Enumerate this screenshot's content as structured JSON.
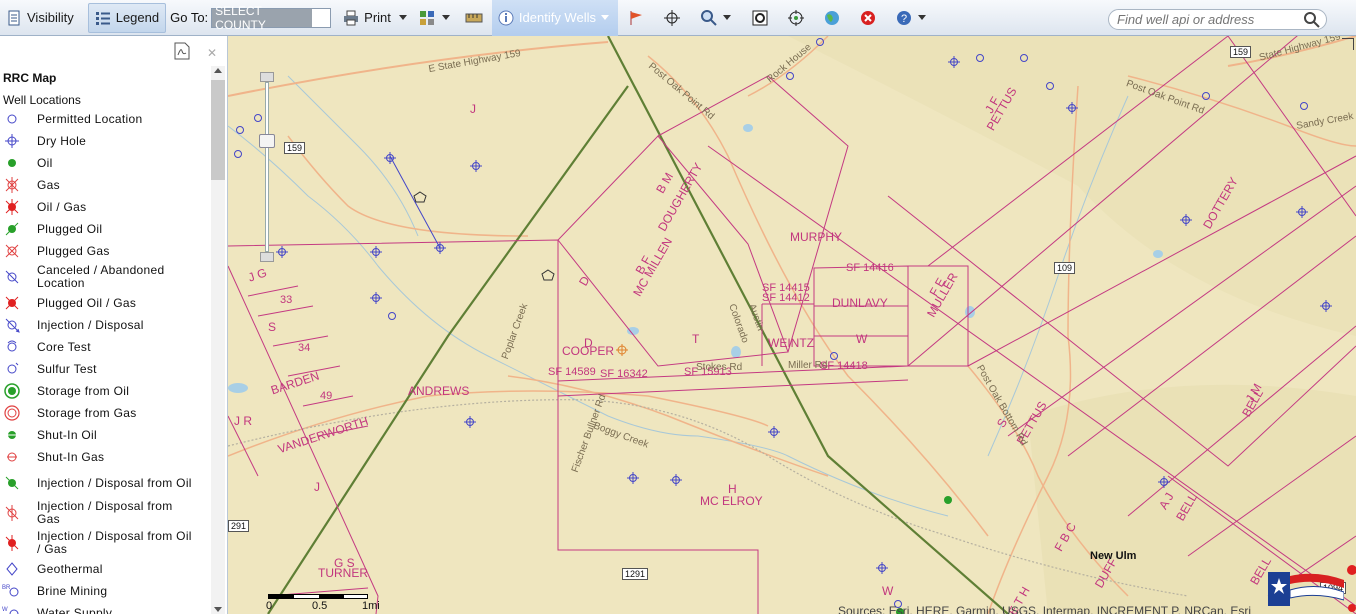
{
  "toolbar": {
    "visibility_label": "Visibility",
    "legend_label": "Legend",
    "goto_label": "Go To:",
    "county_value": "SELECT COUNTY",
    "print_label": "Print",
    "identify_label": "Identify Wells",
    "search_placeholder": "Find well api or address"
  },
  "legend": {
    "title": "RRC Map",
    "subtitle": "Well Locations",
    "items": [
      {
        "label": "Permitted Location",
        "icon": "permitted-location-icon"
      },
      {
        "label": "Dry Hole",
        "icon": "dry-hole-icon"
      },
      {
        "label": "Oil",
        "icon": "oil-icon"
      },
      {
        "label": "Gas",
        "icon": "gas-icon"
      },
      {
        "label": "Oil / Gas",
        "icon": "oil-gas-icon"
      },
      {
        "label": "Plugged Oil",
        "icon": "plugged-oil-icon"
      },
      {
        "label": "Plugged Gas",
        "icon": "plugged-gas-icon"
      },
      {
        "label": "Canceled / Abandoned Location",
        "icon": "canceled-location-icon"
      },
      {
        "label": "Plugged Oil / Gas",
        "icon": "plugged-oil-gas-icon"
      },
      {
        "label": "Injection / Disposal",
        "icon": "injection-disposal-icon"
      },
      {
        "label": "Core Test",
        "icon": "core-test-icon"
      },
      {
        "label": "Sulfur Test",
        "icon": "sulfur-test-icon"
      },
      {
        "label": "Storage from Oil",
        "icon": "storage-oil-icon"
      },
      {
        "label": "Storage from Gas",
        "icon": "storage-gas-icon"
      },
      {
        "label": "Shut-In Oil",
        "icon": "shut-in-oil-icon"
      },
      {
        "label": "Shut-In Gas",
        "icon": "shut-in-gas-icon"
      },
      {
        "label": "Injection / Disposal from Oil",
        "icon": "injection-oil-icon"
      },
      {
        "label": "Injection / Disposal from Gas",
        "icon": "injection-gas-icon"
      },
      {
        "label": "Injection / Disposal from Oil / Gas",
        "icon": "injection-oil-gas-icon"
      },
      {
        "label": "Geothermal",
        "icon": "geothermal-icon"
      },
      {
        "label": "Brine Mining",
        "icon": "brine-mining-icon"
      },
      {
        "label": "Water Supply",
        "icon": "water-supply-icon"
      }
    ]
  },
  "map": {
    "survey_labels": [
      "J",
      "J G",
      "33",
      "S",
      "34",
      "BARDEN",
      "49",
      "J R",
      "VANDERWORTH",
      "J",
      "ANDREWS",
      "G S",
      "TURNER",
      "B F",
      "MC MILLEN",
      "B M",
      "DOUGHERTY",
      "D",
      "D",
      "COOPER",
      "T",
      "SF 14589",
      "SF 16342",
      "SF 15913",
      "MURPHY",
      "SF 14415",
      "SF 14412",
      "SF 14416",
      "DUNLAVY",
      "WEINTZ",
      "W",
      "SF 14418",
      "F E",
      "MULLER",
      "J F",
      "PETTUS",
      "DOTTERY",
      "J M",
      "BELL",
      "S",
      "PETTUS",
      "H",
      "MC ELROY",
      "A J",
      "BELL",
      "F B C",
      "DUFF",
      "BELL",
      "W",
      "E T H"
    ],
    "road_labels": [
      "E State Highway 159",
      "Post Oak Point Rd",
      "Rock House",
      "Post Oak Point Rd",
      "Sandy Creek",
      "State Highway 159",
      "Poplar Creek",
      "Colorado",
      "Austin",
      "Stokes Rd",
      "Miller Rd",
      "Fischer Bullner Rd",
      "Boggy Creek",
      "Post Oak Bottom Rd"
    ],
    "town_label": "New Ulm",
    "shields": [
      "159",
      "159",
      "109",
      "291",
      "1291",
      "1094"
    ],
    "scale": {
      "zero": "0",
      "mid": "0.5",
      "end": "1mi"
    },
    "attribution": "Sources: Esri, HERE, Garmin, USGS, Intermap, INCREMENT P, NRCan, Esri"
  }
}
